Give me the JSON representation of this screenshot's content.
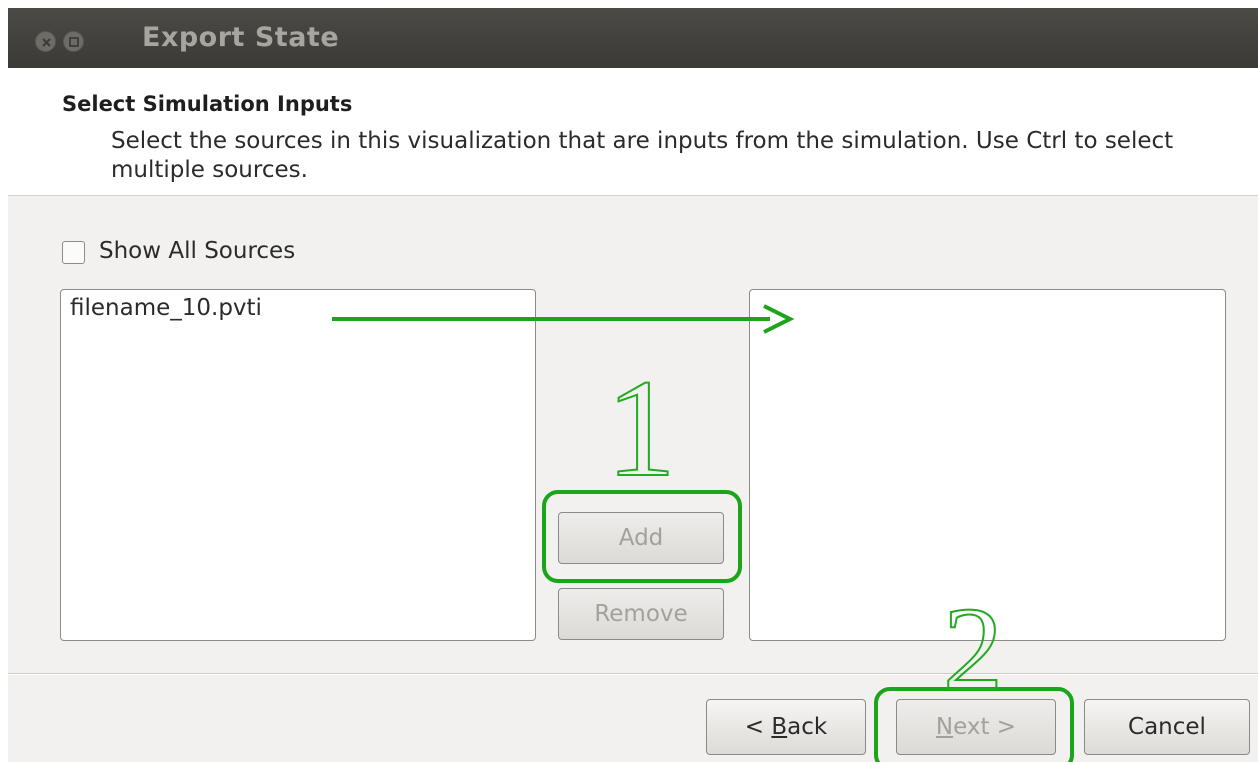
{
  "window": {
    "title": "Export State"
  },
  "header": {
    "title": "Select Simulation Inputs",
    "subtitle": "Select the sources in this visualization that are inputs from the simulation. Use Ctrl to select multiple sources."
  },
  "options": {
    "show_all_sources_label": "Show All Sources",
    "show_all_sources_checked": false
  },
  "source_list": {
    "items": [
      "filename_10.pvti"
    ]
  },
  "selected_list": {
    "items": []
  },
  "middle_buttons": {
    "add_label": "Add",
    "remove_label": "Remove"
  },
  "footer": {
    "back_prefix": "< ",
    "back_mnemonic": "B",
    "back_rest": "ack",
    "next_mnemonic": "N",
    "next_rest": "ext >",
    "cancel_label": "Cancel"
  },
  "annotations": {
    "step1": "1",
    "step2": "2",
    "color": "#22aa22"
  }
}
